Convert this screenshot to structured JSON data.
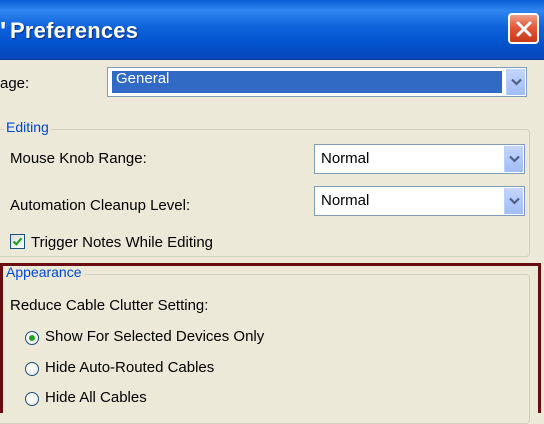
{
  "window": {
    "title_glyph": "'",
    "title": "Preferences"
  },
  "page": {
    "label": "age:",
    "selected": "General"
  },
  "editing": {
    "legend": "Editing",
    "mouse_knob_range_label": "Mouse Knob Range:",
    "mouse_knob_range_value": "Normal",
    "automation_cleanup_label": "Automation Cleanup Level:",
    "automation_cleanup_value": "Normal",
    "trigger_notes_label": "Trigger Notes While Editing",
    "trigger_notes_checked": true
  },
  "appearance": {
    "legend": "Appearance",
    "cable_clutter_label": "Reduce Cable Clutter Setting:",
    "options": [
      {
        "label": "Show For Selected Devices Only",
        "selected": true
      },
      {
        "label": "Hide Auto-Routed Cables",
        "selected": false
      },
      {
        "label": "Hide All Cables",
        "selected": false
      }
    ]
  },
  "colors": {
    "titlebar": "#0a5fd8",
    "legend_text": "#0046d5",
    "selection": "#316ac5",
    "highlight_border": "#6a0d12",
    "radio_dot": "#21a121"
  }
}
